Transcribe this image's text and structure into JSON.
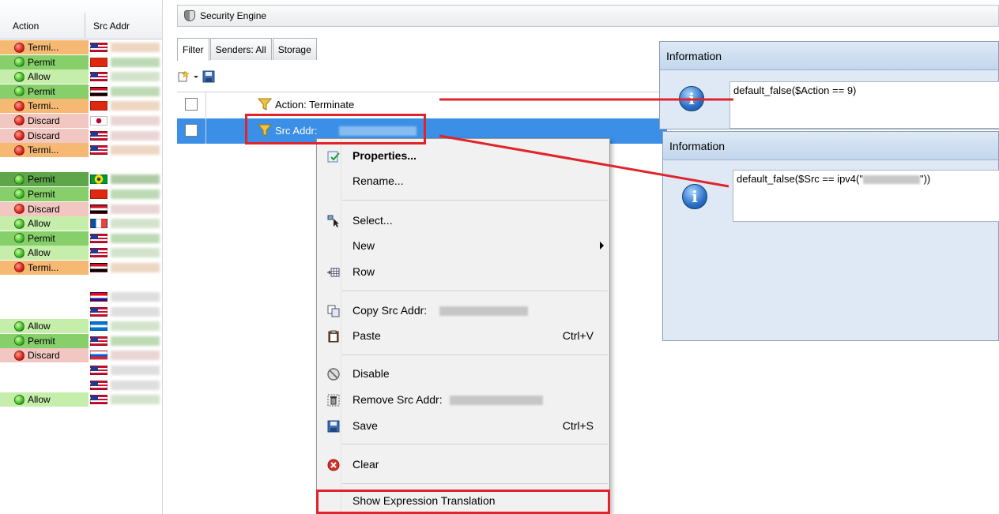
{
  "log_table": {
    "columns": [
      "Action",
      "Src Addr"
    ],
    "rows": [
      {
        "action": "Termi...",
        "status": "red",
        "bg": "#f6b974",
        "flag": "us"
      },
      {
        "action": "Permit",
        "status": "green",
        "bg": "#86cf6b",
        "flag": "cn"
      },
      {
        "action": "Allow",
        "status": "green",
        "bg": "#c5eeaa",
        "flag": "us"
      },
      {
        "action": "Permit",
        "status": "green",
        "bg": "#86cf6b",
        "flag": "eg"
      },
      {
        "action": "Termi...",
        "status": "red",
        "bg": "#f6b974",
        "flag": "cn"
      },
      {
        "action": "Discard",
        "status": "red",
        "bg": "#f2c6c1",
        "flag": "jp"
      },
      {
        "action": "Discard",
        "status": "red",
        "bg": "#f2c6c1",
        "flag": "us"
      },
      {
        "action": "Termi...",
        "status": "red",
        "bg": "#f6b974",
        "flag": "us"
      },
      {
        "action": "",
        "status": "",
        "bg": "#ffffff",
        "flag": ""
      },
      {
        "action": "Permit",
        "status": "green",
        "bg": "#5fa64a",
        "flag": "br"
      },
      {
        "action": "Permit",
        "status": "green",
        "bg": "#86cf6b",
        "flag": "cn"
      },
      {
        "action": "Discard",
        "status": "red",
        "bg": "#f2c6c1",
        "flag": "eg"
      },
      {
        "action": "Allow",
        "status": "green",
        "bg": "#c5eeaa",
        "flag": "fr"
      },
      {
        "action": "Permit",
        "status": "green",
        "bg": "#86cf6b",
        "flag": "us"
      },
      {
        "action": "Allow",
        "status": "green",
        "bg": "#c5eeaa",
        "flag": "us"
      },
      {
        "action": "Termi...",
        "status": "red",
        "bg": "#f6b974",
        "flag": "eg"
      },
      {
        "action": "",
        "status": "",
        "bg": "#ffffff",
        "flag": ""
      },
      {
        "action": "",
        "status": "",
        "bg": "#ffffff",
        "flag": "hr"
      },
      {
        "action": "",
        "status": "",
        "bg": "#ffffff",
        "flag": "us"
      },
      {
        "action": "Allow",
        "status": "green",
        "bg": "#c5eeaa",
        "flag": "hn"
      },
      {
        "action": "Permit",
        "status": "green",
        "bg": "#86cf6b",
        "flag": "us"
      },
      {
        "action": "Discard",
        "status": "red",
        "bg": "#f2c6c1",
        "flag": "si"
      },
      {
        "action": "",
        "status": "",
        "bg": "#ffffff",
        "flag": "us"
      },
      {
        "action": "",
        "status": "",
        "bg": "#ffffff",
        "flag": "us"
      },
      {
        "action": "Allow",
        "status": "green",
        "bg": "#c5eeaa",
        "flag": "us"
      }
    ]
  },
  "security_engine": {
    "title": "Security Engine",
    "tabs": [
      "Filter",
      "Senders: All",
      "Storage"
    ],
    "filters": [
      {
        "label": "Action: Terminate",
        "selected": false
      },
      {
        "label": "Src Addr:",
        "selected": true
      }
    ]
  },
  "context_menu": {
    "items": [
      {
        "label": "Properties...",
        "icon": "properties-icon",
        "bold": true
      },
      {
        "label": "Rename...",
        "icon": ""
      },
      {
        "label": "Select...",
        "icon": "select-icon"
      },
      {
        "label": "New",
        "icon": "",
        "submenu": true
      },
      {
        "label": "Row",
        "icon": "row-icon"
      },
      {
        "label": "Copy Src Addr:",
        "icon": "copy-icon"
      },
      {
        "label": "Paste",
        "icon": "paste-icon",
        "shortcut": "Ctrl+V"
      },
      {
        "label": "Disable",
        "icon": "disable-icon"
      },
      {
        "label": "Remove Src Addr:",
        "icon": "remove-icon"
      },
      {
        "label": "Save",
        "icon": "save-icon",
        "shortcut": "Ctrl+S"
      },
      {
        "label": "Clear",
        "icon": "clear-icon"
      },
      {
        "label": "Show Expression Translation",
        "icon": ""
      }
    ]
  },
  "info_dialogs": [
    {
      "title": "Information",
      "expression": "default_false($Action == 9)"
    },
    {
      "title": "Information",
      "expression_prefix": "default_false($Src == ipv4(\"",
      "expression_suffix": "\"))"
    }
  ],
  "colors": {
    "selection": "#3b8fe6",
    "highlight_annotation": "#e0242a",
    "terminate": "#f6b974",
    "permit": "#86cf6b",
    "allow": "#c5eeaa",
    "discard": "#f2c6c1"
  }
}
